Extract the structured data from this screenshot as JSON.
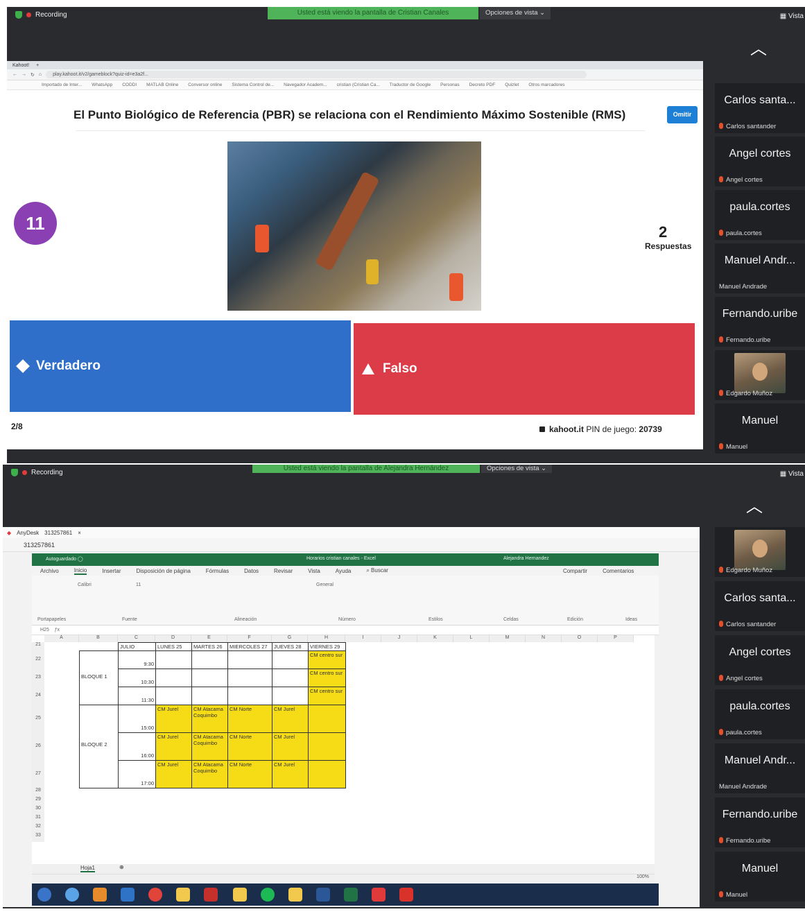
{
  "meeting1": {
    "recording": "Recording",
    "banner": "Usted está viendo la pantalla de Cristian Canales",
    "view_options": "Opciones de vista",
    "vista": "Vista",
    "browser": {
      "tab": "Kahoot!",
      "url": "play.kahoot.it/v2/gameblock?quiz-id=e3a2f...",
      "bookmarks": [
        "Importado de Inter...",
        "WhatsApp",
        "CODDI",
        "MATLAB Online",
        "Conversor online",
        "Sistema Control de...",
        "Navegador Academ...",
        "cristian (Cristian Ca...",
        "Traductor de Google",
        "Personas",
        "Decreto PDF",
        "Quizlet",
        "Otros marcadores"
      ]
    },
    "kahoot": {
      "question": "El Punto Biológico de Referencia (PBR) se relaciona con el Rendimiento Máximo Sostenible (RMS)",
      "skip_label": "Omitir",
      "timer": "11",
      "answers_count": "2",
      "answers_label": "Respuestas",
      "answer_true": "Verdadero",
      "answer_false": "Falso",
      "progress": "2/8",
      "site": "kahoot.it",
      "pin_label": "PIN de juego:",
      "pin": "20739"
    },
    "participants": [
      {
        "display": "Carlos santa...",
        "name": "Carlos santander"
      },
      {
        "display": "Angel cortes",
        "name": "Angel cortes"
      },
      {
        "display": "paula.cortes",
        "name": "paula.cortes"
      },
      {
        "display": "Manuel Andr...",
        "name": "Manuel Andrade"
      },
      {
        "display": "Fernando.uribe",
        "name": "Fernando.uribe"
      },
      {
        "display": "",
        "name": "Edgardo Muñoz"
      },
      {
        "display": "Manuel",
        "name": "Manuel"
      }
    ]
  },
  "meeting2": {
    "recording": "Recording",
    "banner": "Usted está viendo la pantalla de Alejandra Hernández",
    "view_options": "Opciones de vista",
    "vista": "Vista",
    "anydesk": {
      "app": "AnyDesk",
      "id": "313257861"
    },
    "excel": {
      "title": "Horarios cristian canales - Excel",
      "user": "Alejandra Hernandez",
      "tabs": [
        "Archivo",
        "Inicio",
        "Insertar",
        "Disposición de página",
        "Fórmulas",
        "Datos",
        "Revisar",
        "Vista",
        "Ayuda",
        "Buscar"
      ],
      "share": "Compartir",
      "comments": "Comentarios",
      "groups": [
        "Portapapeles",
        "Fuente",
        "Alineación",
        "Número",
        "Estilos",
        "Celdas",
        "Edición",
        "Ideas"
      ],
      "font": "Calibri",
      "font_size": "11",
      "number_format": "General",
      "name_box": "H25",
      "columns": [
        "A",
        "B",
        "C",
        "D",
        "E",
        "F",
        "G",
        "H",
        "I",
        "J",
        "K",
        "L",
        "M",
        "N",
        "O",
        "P"
      ],
      "rows": [
        "21",
        "22",
        "23",
        "24",
        "25",
        "26",
        "27",
        "28",
        "29",
        "30",
        "31",
        "32",
        "33"
      ],
      "header_row": [
        "JULIO",
        "LUNES 25",
        "MARTES 26",
        "MIERCOLES 27",
        "JUEVES 28",
        "VIERNES 29"
      ],
      "block1": "BLOQUE 1",
      "block2": "BLOQUE 2",
      "times": [
        "9:30",
        "10:30",
        "11:30",
        "15:00",
        "16:00",
        "17:00"
      ],
      "cm_centro": "CM centro sur",
      "cm_jurel": "CM Jurel",
      "cm_atacama": "CM Atacama Coquimbo",
      "cm_norte": "CM Norte",
      "sheet_tab": "Hoja1",
      "zoom": "100%"
    },
    "participants": [
      {
        "display": "",
        "name": "Edgardo Muñoz"
      },
      {
        "display": "Carlos santa...",
        "name": "Carlos santander"
      },
      {
        "display": "Angel cortes",
        "name": "Angel cortes"
      },
      {
        "display": "paula.cortes",
        "name": "paula.cortes"
      },
      {
        "display": "Manuel Andr...",
        "name": "Manuel Andrade"
      },
      {
        "display": "Fernando.uribe",
        "name": "Fernando.uribe"
      },
      {
        "display": "Manuel",
        "name": "Manuel"
      }
    ]
  },
  "colors": {
    "meeting_bg": "#2a2b2e",
    "banner": "#4fb35a",
    "kahoot_blue": "#2f6fc9",
    "kahoot_red": "#dc3c48",
    "kahoot_purple": "#8a3fb3",
    "excel_green": "#217346",
    "cell_yellow": "#f6dc16"
  }
}
